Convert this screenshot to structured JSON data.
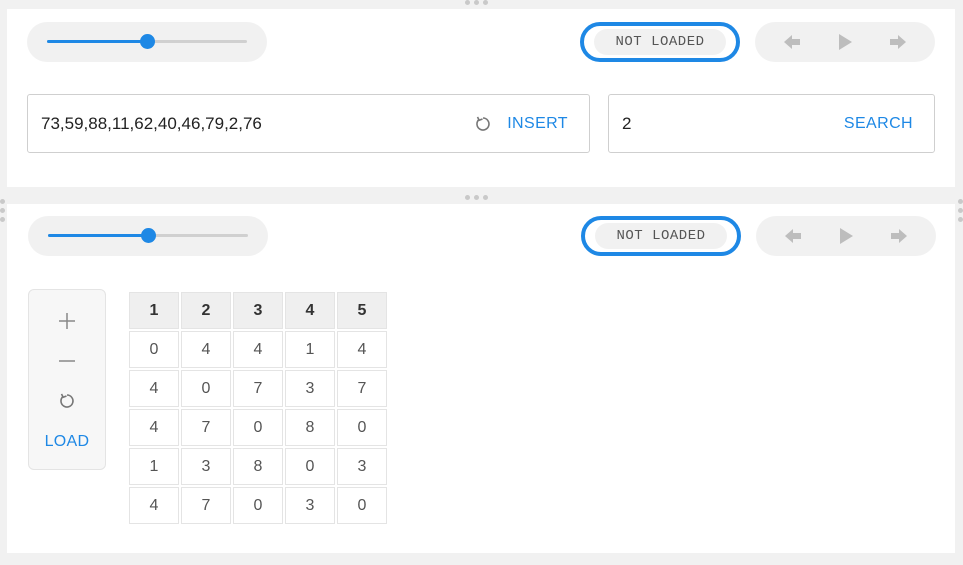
{
  "top": {
    "slider": {
      "value": 0.5
    },
    "status": "NOT LOADED",
    "player": {
      "icons": [
        "step-back-icon",
        "play-icon",
        "step-forward-icon"
      ]
    },
    "insert": {
      "value": "73,59,88,11,62,40,46,79,2,76",
      "action_label": "INSERT"
    },
    "search": {
      "value": "2",
      "action_label": "SEARCH"
    }
  },
  "bottom": {
    "slider": {
      "value": 0.5
    },
    "status": "NOT LOADED",
    "player": {
      "icons": [
        "step-back-icon",
        "play-icon",
        "step-forward-icon"
      ]
    },
    "tools": {
      "icons": [
        "plus-icon",
        "minus-icon",
        "reset-icon"
      ],
      "load_label": "LOAD"
    },
    "matrix": {
      "headers": [
        "1",
        "2",
        "3",
        "4",
        "5"
      ],
      "rows": [
        [
          "0",
          "4",
          "4",
          "1",
          "4"
        ],
        [
          "4",
          "0",
          "7",
          "3",
          "7"
        ],
        [
          "4",
          "7",
          "0",
          "8",
          "0"
        ],
        [
          "1",
          "3",
          "8",
          "0",
          "3"
        ],
        [
          "4",
          "7",
          "0",
          "3",
          "0"
        ]
      ]
    }
  },
  "colors": {
    "accent": "#1e88e5",
    "control_bg": "#f1f1f1",
    "icon_gray": "#bdbdbd"
  }
}
